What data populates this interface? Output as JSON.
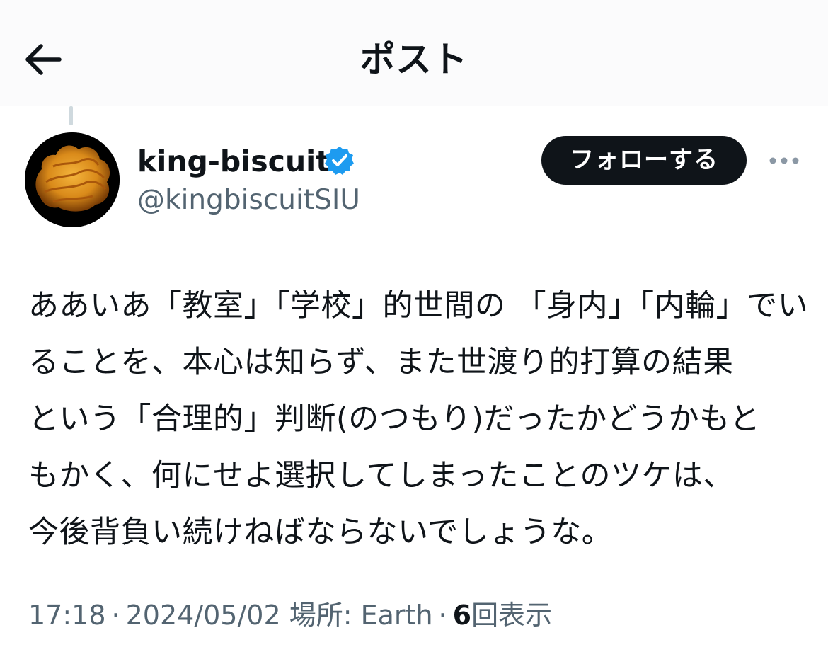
{
  "header": {
    "title": "ポスト",
    "back_icon": "arrow-left-icon"
  },
  "author": {
    "display_name": "king-biscuit",
    "handle": "@kingbiscuitSIU",
    "verified_icon": "verified-badge-icon",
    "verified_color": "#1d9bf0"
  },
  "actions": {
    "follow_label": "フォローする",
    "more_icon": "more-horizontal-icon"
  },
  "tweet": {
    "lines": [
      "ああいあ「教室」「学校」的世間の 「身内」「内輪」でい",
      "ることを、本心は知らず、また世渡り的打算の結果",
      "という「合理的」判断(のつもり)だったかどうかもと",
      "もかく、何にせよ選択してしまったことのツケは、",
      "今後背負い続けねばならないでしょうな。"
    ]
  },
  "meta": {
    "time": "17:18",
    "date": "2024/05/02",
    "location_label": "場所:",
    "location": "Earth",
    "views_count": "6",
    "views_label": "回表示"
  },
  "colors": {
    "text": "#0f1419",
    "secondary": "#536471",
    "follow_bg": "#0f1419",
    "follow_text": "#ffffff"
  }
}
